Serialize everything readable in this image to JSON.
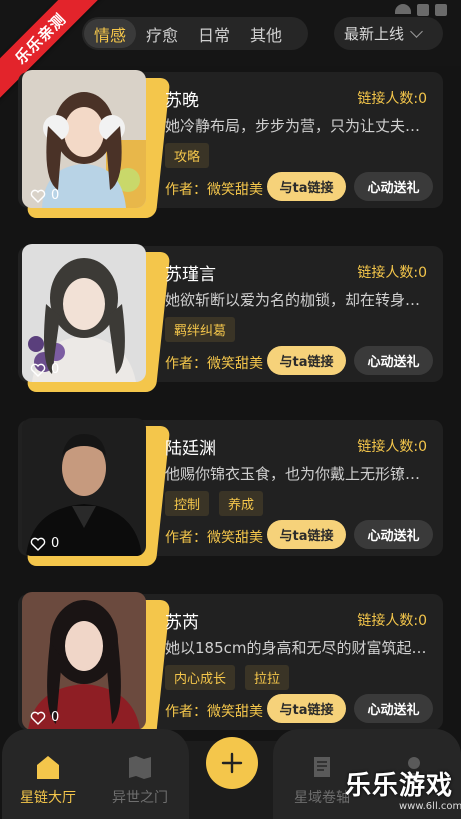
{
  "ribbon": "乐乐亲测",
  "tabs": [
    "情感",
    "疗愈",
    "日常",
    "其他"
  ],
  "sort": {
    "label": "最新上线"
  },
  "cards": [
    {
      "name": "苏晚",
      "link_count": "链接人数:0",
      "desc": "她冷静布局，步步为营，只为让丈夫…",
      "tags": [
        "攻略"
      ],
      "author": "作者：微笑甜美",
      "likes": "0",
      "link_btn": "与ta链接",
      "gift_btn": "心动送礼"
    },
    {
      "name": "苏瑾言",
      "link_count": "链接人数:0",
      "desc": "她欲斩断以爱为名的枷锁，却在转身…",
      "tags": [
        "羁绊纠葛"
      ],
      "author": "作者：微笑甜美",
      "likes": "0",
      "link_btn": "与ta链接",
      "gift_btn": "心动送礼"
    },
    {
      "name": "陆廷渊",
      "link_count": "链接人数:0",
      "desc": "他赐你锦衣玉食，也为你戴上无形镣…",
      "tags": [
        "控制",
        "养成"
      ],
      "author": "作者：微笑甜美",
      "likes": "0",
      "link_btn": "与ta链接",
      "gift_btn": "心动送礼"
    },
    {
      "name": "苏芮",
      "link_count": "链接人数:0",
      "desc": "她以185cm的身高和无尽的财富筑起…",
      "tags": [
        "内心成长",
        "拉拉"
      ],
      "author": "作者：微笑甜美",
      "likes": "0",
      "link_btn": "与ta链接",
      "gift_btn": "心动送礼"
    }
  ],
  "nav": {
    "items": [
      {
        "label": "星链大厅",
        "icon": "home-icon"
      },
      {
        "label": "异世之门",
        "icon": "map-icon"
      },
      {
        "label": "星域卷轴",
        "icon": "scroll-icon"
      },
      {
        "label": "",
        "icon": "profile-icon"
      }
    ]
  },
  "watermark": {
    "title": "乐乐游戏",
    "url": "www.6ll.com"
  },
  "colors": {
    "accent": "#f4c64b",
    "background": "#141414",
    "card": "#212121",
    "ribbon": "#e3242b"
  }
}
